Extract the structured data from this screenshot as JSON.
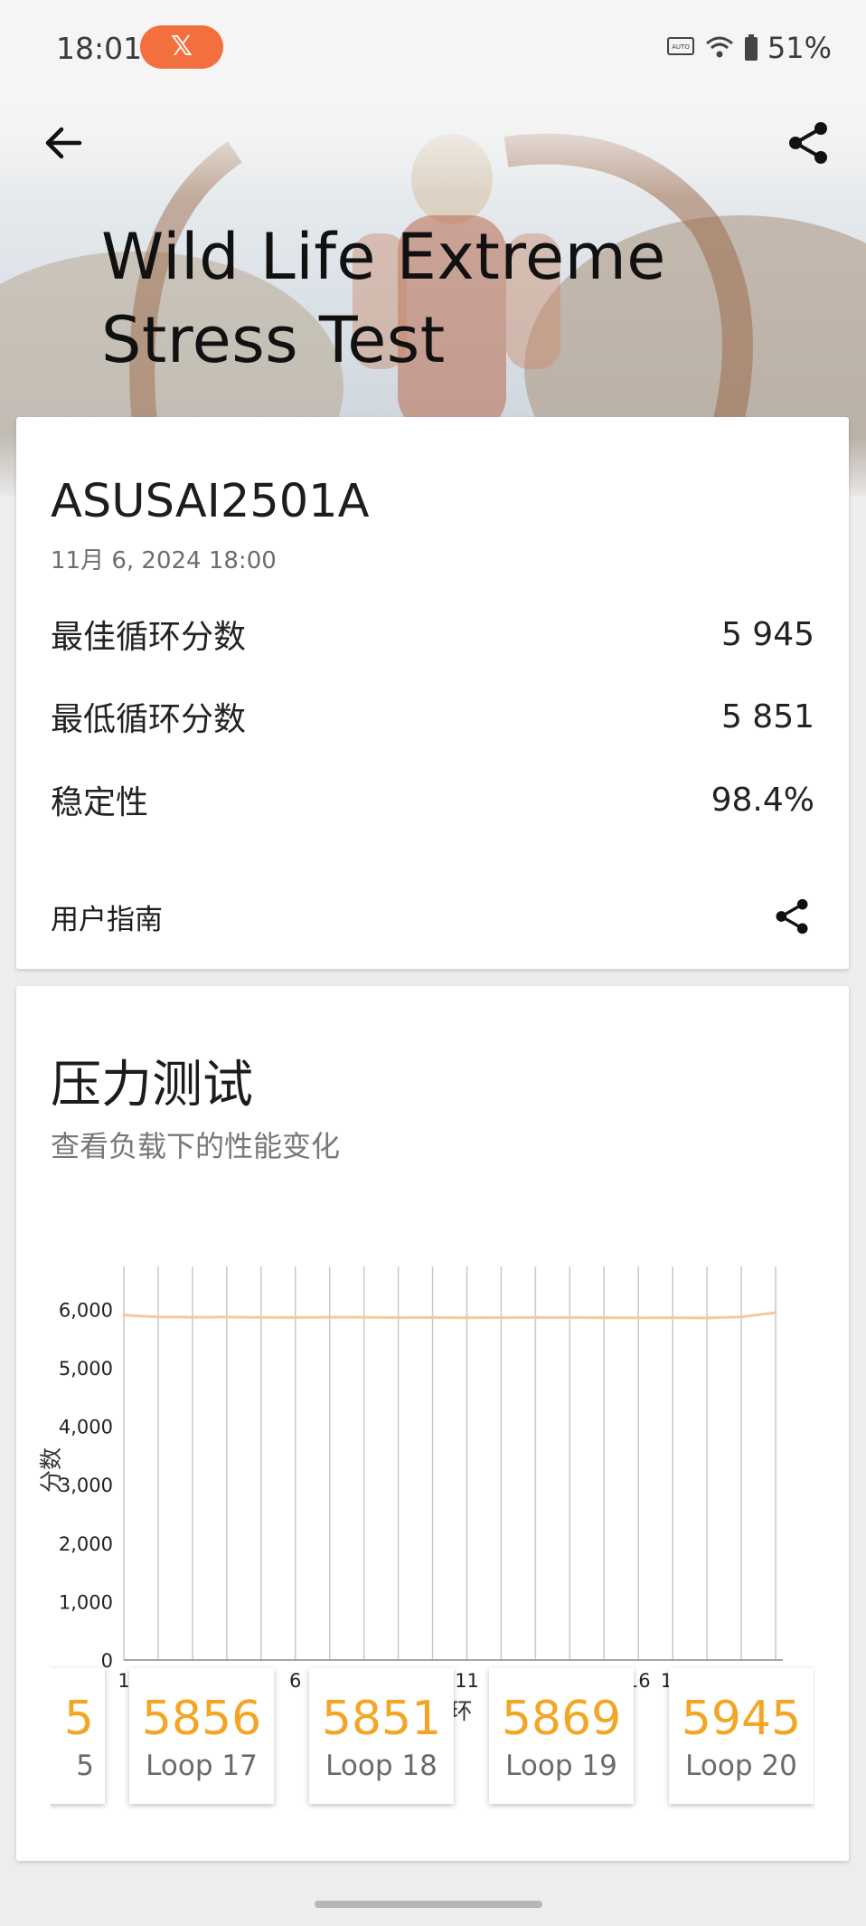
{
  "status": {
    "time": "18:01",
    "battery": "51%"
  },
  "header": {
    "title_line1": "Wild Life Extreme",
    "title_line2": "Stress Test"
  },
  "result": {
    "device": "ASUSAI2501A",
    "date": "11月 6, 2024 18:00",
    "metrics": [
      {
        "label": "最佳循环分数",
        "value": "5 945"
      },
      {
        "label": "最低循环分数",
        "value": "5 851"
      },
      {
        "label": "稳定性",
        "value": "98.4%"
      }
    ],
    "guide_label": "用户指南"
  },
  "stress": {
    "title": "压力测试",
    "subtitle": "查看负载下的性能变化"
  },
  "chart_data": {
    "type": "line",
    "x": [
      1,
      2,
      3,
      4,
      5,
      6,
      7,
      8,
      9,
      10,
      11,
      12,
      13,
      14,
      15,
      16,
      17,
      18,
      19,
      20
    ],
    "series": [
      {
        "values": [
          5900,
          5870,
          5865,
          5868,
          5862,
          5860,
          5866,
          5863,
          5858,
          5860,
          5855,
          5857,
          5859,
          5860,
          5856,
          5854,
          5856,
          5851,
          5869,
          5945
        ]
      }
    ],
    "xlabel": "循环",
    "ylabel": "分数",
    "yticks": [
      "0",
      "1,000",
      "2,000",
      "3,000",
      "4,000",
      "5,000",
      "6,000"
    ],
    "ylim": [
      0,
      6500
    ],
    "grid": "vertical",
    "line_color": "#f5c99a"
  },
  "loops": [
    {
      "score": "5",
      "label": "5"
    },
    {
      "score": "5856",
      "label": "Loop 17"
    },
    {
      "score": "5851",
      "label": "Loop 18"
    },
    {
      "score": "5869",
      "label": "Loop 19"
    },
    {
      "score": "5945",
      "label": "Loop 20"
    }
  ],
  "colors": {
    "accent": "#f3a626",
    "badge": "#f36f3e"
  }
}
